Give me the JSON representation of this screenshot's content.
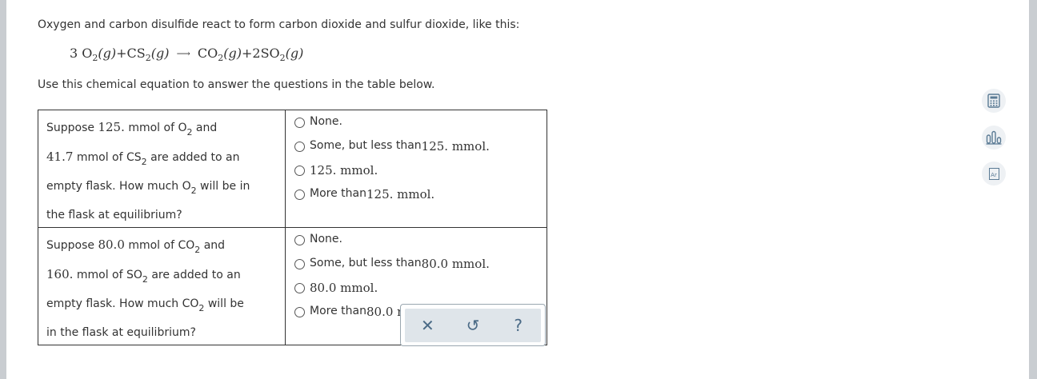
{
  "intro": "Oxygen and carbon disulfide react to form carbon dioxide and sulfur dioxide, like this:",
  "equation": {
    "coef1": "3",
    "r1": "O",
    "r1_sub": "2",
    "r1_state": "(g)",
    "plus1": "+",
    "r2": "CS",
    "r2_sub": "2",
    "r2_state": "(g)",
    "p1": "CO",
    "p1_sub": "2",
    "p1_state": "(g)",
    "plus2": "+",
    "coef2": "2",
    "p2": "SO",
    "p2_sub": "2",
    "p2_state": "(g)"
  },
  "instruction": "Use this chemical equation to answer the questions in the table below.",
  "questions": [
    {
      "text": {
        "a": "Suppose ",
        "n1": "125.",
        "b": " mmol of O",
        "s1": "2",
        "c": " and",
        "n2": "41.7",
        "d": " mmol of CS",
        "s2": "2",
        "e": " are added to an",
        "f": "empty flask. How much O",
        "s3": "2",
        "g": " will be in",
        "h": "the flask at equilibrium?"
      },
      "options": [
        {
          "text": "None.",
          "value": ""
        },
        {
          "text": "Some, but less than ",
          "value": "125. mmol."
        },
        {
          "text": "",
          "value": "125. mmol."
        },
        {
          "text": "More than ",
          "value": "125. mmol."
        }
      ]
    },
    {
      "text": {
        "a": "Suppose ",
        "n1": "80.0",
        "b": " mmol of CO",
        "s1": "2",
        "c": " and",
        "n2": "160.",
        "d": " mmol of SO",
        "s2": "2",
        "e": " are added to an",
        "f": "empty flask. How much CO",
        "s3": "2",
        "g": " will be",
        "h": "in the flask at equilibrium?"
      },
      "options": [
        {
          "text": "None.",
          "value": ""
        },
        {
          "text": "Some, but less than ",
          "value": "80.0 mmol."
        },
        {
          "text": "",
          "value": "80.0 mmol."
        },
        {
          "text": "More than ",
          "value": "80.0 mmol."
        }
      ]
    }
  ],
  "toolbar": {
    "clear_symbol": "✕",
    "undo_symbol": "↺",
    "help_symbol": "?"
  },
  "side_tools": [
    "calculator-icon",
    "chart-icon",
    "periodic-table-icon"
  ],
  "side_tool_labels": {
    "periodic": "Ar"
  },
  "colors": {
    "background": "#c9cdd1",
    "toolbar": "#dfe5ea",
    "icon": "#4a6a86"
  }
}
